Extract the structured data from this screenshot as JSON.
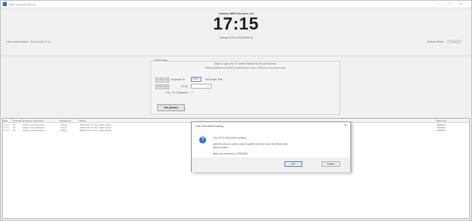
{
  "window": {
    "title": "Time Clock (ATHELO)",
    "controls": [
      "–",
      "☐",
      "✕"
    ]
  },
  "header": {
    "company": "Aviation MRO Services Ltd",
    "clock": "17:15",
    "datetime": "Tuesday 26 Dec 2016 (Week 5)",
    "last_comm": "Last Communication : 26-Jan-2016 17:14",
    "network_label": "Network Status :",
    "network_value": "Offline"
  },
  "job_booking": {
    "legend": "Job Booking",
    "instruction_line1": "Swipe or type your ID number followed by the job barcode.",
    "instruction_line2": "Select Add/Remove [Enter] to submit your entry or [Esc] to cancel your card.",
    "lookup_buttons": [
      "Lookup (F1)",
      "Lookup (F2)"
    ],
    "employee_label": "Employee ID",
    "employee_value": "00024",
    "employee_name": "McDonald, Pete",
    "job_label": "Job ID",
    "job_value": "",
    "pct_label": "(F3) : On Completion :",
    "pct_value": "7",
    "ok_button": "OK (Enter)"
  },
  "grid": {
    "columns": [
      "Date",
      "Clock ID",
      "Employee / Description",
      "Booking No",
      "Details",
      "Batch Job"
    ],
    "rows": [
      [
        "17:14",
        "03",
        "Gilliland, Bernard/Shaun",
        "Project",
        "WD1/0735 / On Res. 0006 (Stand)",
        "00000007"
      ],
      [
        "17:14",
        "03",
        "Gilliland, Bernard/Shaun",
        "Project",
        "WD1/0735 / On Res. 0006 (Stand)",
        "00000007"
      ],
      [
        "17:14",
        "03",
        "Gilliland, Bernard/Shaun",
        "Project",
        "WD1/0735 / On Res. 0006 (Stand)",
        "00000007"
      ]
    ]
  },
  "dialog": {
    "title": "Time Clock Batch Booking",
    "icon": "question-icon",
    "line1": "Click OK to start batch booking.",
    "line2": "Add the jobs you want to batch together and then click the [Enter] task",
    "line3": "Batch position.",
    "line4": "Batch job reference is 20000000",
    "ok_label": "OK",
    "cancel_label": "Cancel"
  }
}
